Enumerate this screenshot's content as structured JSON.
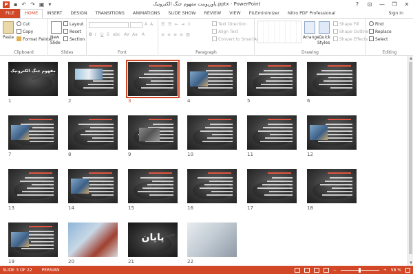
{
  "window": {
    "app_icon": "P",
    "title": "پاورپوینت مفهوم جنگ الکترونیک.pptx - PowerPoint",
    "controls": [
      "?",
      "⊡",
      "—",
      "❐",
      "✕"
    ],
    "sign_in": "Sign in"
  },
  "tabs": [
    "FILE",
    "HOME",
    "INSERT",
    "DESIGN",
    "TRANSITIONS",
    "ANIMATIONS",
    "SLIDE SHOW",
    "REVIEW",
    "VIEW",
    "FILEminimizer",
    "Nitro PDF Professional"
  ],
  "active_tab": "HOME",
  "ribbon": {
    "clipboard": {
      "label": "Clipboard",
      "paste": "Paste",
      "cut": "Cut",
      "copy": "Copy",
      "format_painter": "Format Painter"
    },
    "slides": {
      "label": "Slides",
      "new_slide": "New",
      "new_slide2": "Slide",
      "layout": "Layout",
      "reset": "Reset",
      "section": "Section"
    },
    "font": {
      "label": "Font"
    },
    "paragraph": {
      "label": "Paragraph",
      "text_direction": "Text Direction",
      "align_text": "Align Text",
      "convert_smartart": "Convert to SmartArt"
    },
    "drawing": {
      "label": "Drawing",
      "arrange": "Arrange",
      "quick_styles": "Quick",
      "quick_styles2": "Styles",
      "shape_fill": "Shape Fill",
      "shape_outline": "Shape Outline",
      "shape_effects": "Shape Effects"
    },
    "editing": {
      "label": "Editing",
      "find": "Find",
      "replace": "Replace",
      "select": "Select"
    }
  },
  "slides": [
    {
      "num": "1",
      "kind": "title",
      "title_text": "مفهوم جنگ الکترونیک"
    },
    {
      "num": "2",
      "kind": "photo-top"
    },
    {
      "num": "3",
      "kind": "text",
      "selected": true
    },
    {
      "num": "4",
      "kind": "photo-left"
    },
    {
      "num": "5",
      "kind": "text"
    },
    {
      "num": "6",
      "kind": "text"
    },
    {
      "num": "7",
      "kind": "photo-left"
    },
    {
      "num": "8",
      "kind": "text"
    },
    {
      "num": "9",
      "kind": "photo-center"
    },
    {
      "num": "10",
      "kind": "text"
    },
    {
      "num": "11",
      "kind": "text"
    },
    {
      "num": "12",
      "kind": "photo-left"
    },
    {
      "num": "13",
      "kind": "text"
    },
    {
      "num": "14",
      "kind": "photo-left"
    },
    {
      "num": "15",
      "kind": "text"
    },
    {
      "num": "16",
      "kind": "text"
    },
    {
      "num": "17",
      "kind": "text"
    },
    {
      "num": "18",
      "kind": "text"
    },
    {
      "num": "19",
      "kind": "photo-left"
    },
    {
      "num": "20",
      "kind": "photo-full"
    },
    {
      "num": "21",
      "kind": "end",
      "title_text": "پایان"
    },
    {
      "num": "22",
      "kind": "photo-full-light"
    }
  ],
  "status": {
    "slide_indicator": "SLIDE 3 OF 22",
    "language": "PERSIAN",
    "zoom": "58 %"
  },
  "colors": {
    "accent": "#d24726",
    "slide_bg": "#3a3a3a",
    "selected_outline": "#d24726"
  }
}
